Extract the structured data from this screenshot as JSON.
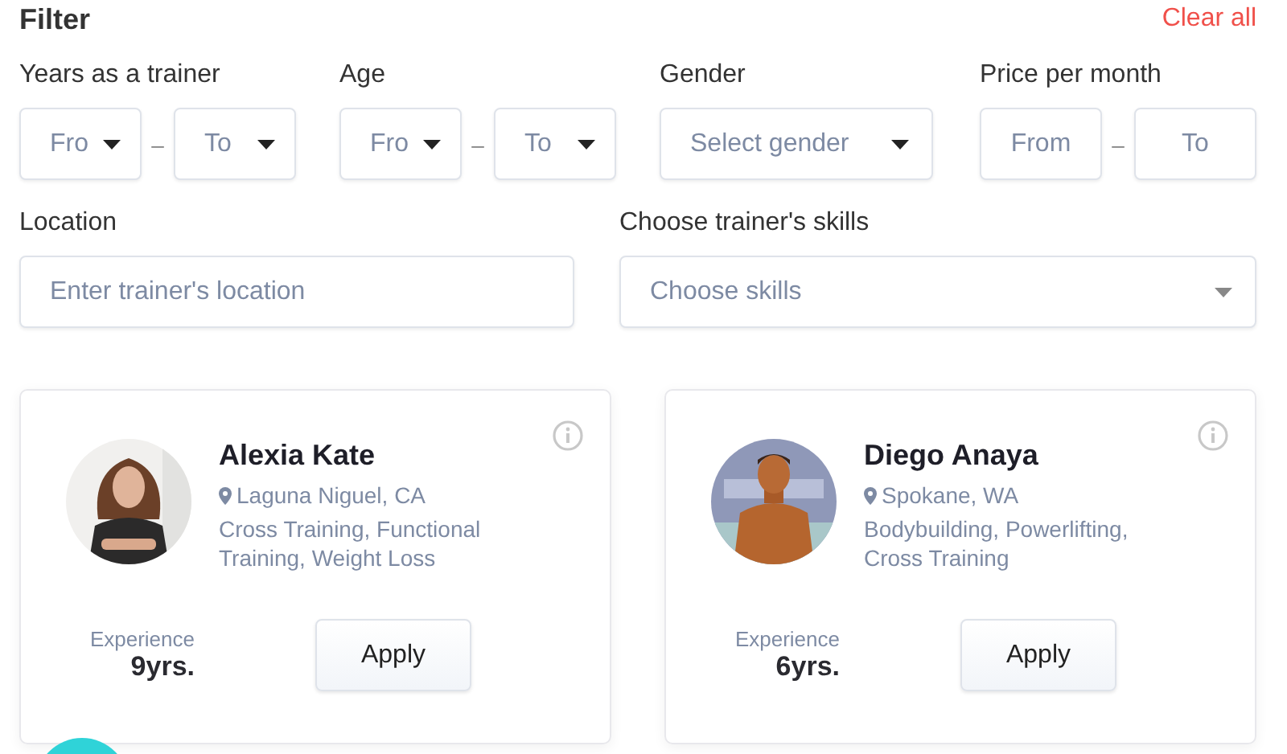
{
  "header": {
    "title": "Filter",
    "clear_link": "Clear all"
  },
  "filters": [
    {
      "kind": "range-dropdown",
      "label": "Years as a trainer",
      "from": "Fro",
      "separator": "–",
      "to": "To"
    },
    {
      "kind": "range-dropdown",
      "label": "Age",
      "from": "Fro",
      "separator": "–",
      "to": "To"
    },
    {
      "kind": "select",
      "label": "Gender",
      "placeholder": "Select gender"
    },
    {
      "kind": "range-input",
      "label": "Price per month",
      "from_placeholder": "From",
      "separator": "–",
      "to_placeholder": "To"
    }
  ],
  "location": {
    "label": "Location",
    "placeholder": "Enter trainer's location"
  },
  "skills": {
    "label": "Choose trainer's skills",
    "placeholder": "Choose skills"
  },
  "trainers": [
    {
      "name": "Alexia Kate",
      "location": "Laguna Niguel, CA",
      "skills": "Cross Training, Functional Training, Weight Loss",
      "experience_label": "Experience",
      "experience": "9yrs.",
      "button": "Apply"
    },
    {
      "name": "Diego Anaya",
      "location": "Spokane, WA",
      "skills": "Bodybuilding, Powerlifting, Cross Training",
      "experience_label": "Experience",
      "experience": "6yrs.",
      "button": "Apply"
    }
  ],
  "floating_button": {
    "kind": "fab"
  }
}
